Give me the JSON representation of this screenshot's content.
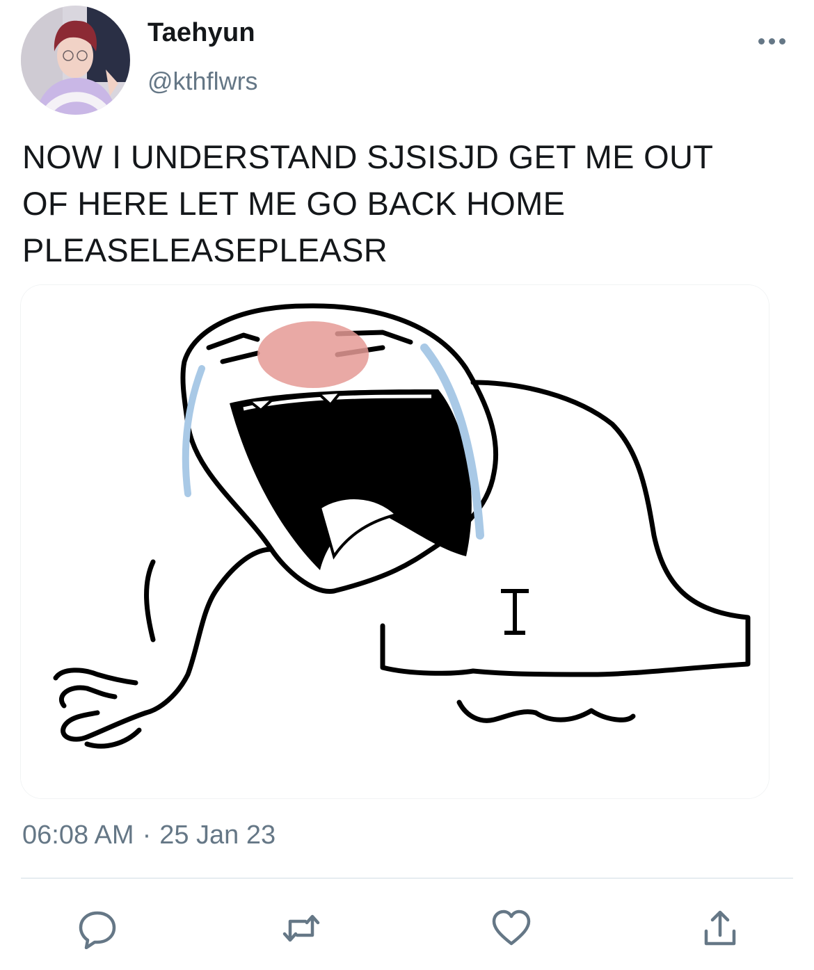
{
  "user": {
    "display_name": "Taehyun",
    "handle": "@kthflwrs",
    "avatar_icon": "profile-photo"
  },
  "tweet": {
    "text": "NOW I UNDERSTAND SJSISJD GET ME OUT\nOF HERE LET ME GO BACK HOME\nPLEASELEASEPLEASR",
    "media_description_icon": "crying-cartoon-image",
    "time": "06:08 AM",
    "separator": "·",
    "date": "25 Jan 23"
  },
  "actions": {
    "reply_icon": "reply-icon",
    "retweet_icon": "retweet-icon",
    "like_icon": "heart-icon",
    "share_icon": "share-icon"
  },
  "colors": {
    "primary_text": "#14171a",
    "secondary_text": "#657786",
    "divider": "#e6ecf0",
    "icon": "#657786",
    "blush": "#e59a95",
    "tears": "#a9c9e6"
  }
}
